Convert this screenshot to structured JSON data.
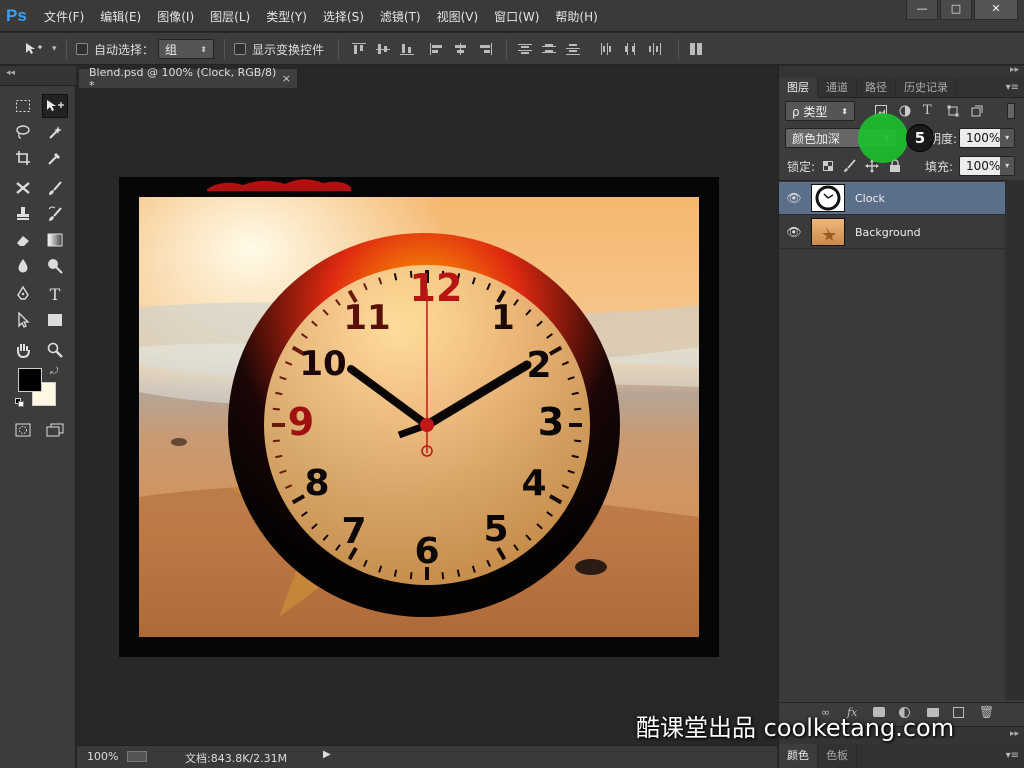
{
  "app": {
    "logo": "Ps",
    "menus": [
      "文件(F)",
      "编辑(E)",
      "图像(I)",
      "图层(L)",
      "类型(Y)",
      "选择(S)",
      "滤镜(T)",
      "视图(V)",
      "窗口(W)",
      "帮助(H)"
    ],
    "window_buttons": [
      "—",
      "□",
      "✕"
    ]
  },
  "options": {
    "auto_select_label": "自动选择：",
    "auto_select_value": "组",
    "show_transform_label": "显示变换控件"
  },
  "document": {
    "tab_title": "Blend.psd @ 100% (Clock, RGB/8) *",
    "tab_close": "×",
    "zoom": "100%",
    "doc_info": "文档:843.8K/2.31M"
  },
  "clock": {
    "numbers": [
      "12",
      "1",
      "2",
      "3",
      "4",
      "5",
      "6",
      "7",
      "8",
      "9",
      "10",
      "11"
    ]
  },
  "panels": {
    "tabs": [
      "图层",
      "通道",
      "路径",
      "历史记录"
    ],
    "filter_kind": "ρ 类型",
    "blend_mode": "颜色加深",
    "opacity_label": "不透明度:",
    "opacity_value": "100%",
    "lock_label": "锁定:",
    "fill_label": "填充:",
    "fill_value": "100%",
    "layers": [
      {
        "name": "Clock",
        "selected": true
      },
      {
        "name": "Background",
        "selected": false
      }
    ],
    "bottom_tabs": [
      "颜色",
      "色板"
    ]
  },
  "overlay": {
    "step_number": "5",
    "watermark": "酷课堂出品 coolketang.com"
  },
  "colors": {
    "accent": "#3aa0f5",
    "selected_layer": "#5b6e8a",
    "click_marker": "#1dbf2e"
  }
}
